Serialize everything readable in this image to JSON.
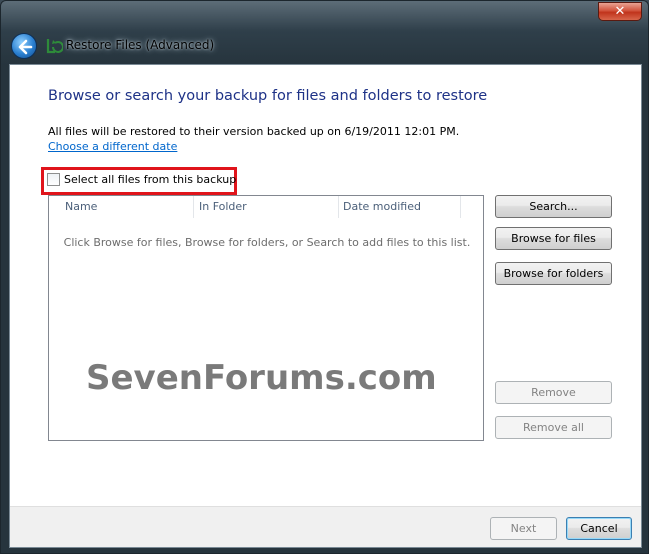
{
  "window": {
    "title": "Restore Files (Advanced)",
    "close_label": "✕"
  },
  "main": {
    "heading": "Browse or search your backup for files and folders to restore",
    "info_text": "All files will be restored to their version backed up on 6/19/2011 12:01 PM.",
    "change_date_link": "Choose a different date",
    "select_all_label": "Select all files from this backup",
    "select_all_checked": false
  },
  "list": {
    "columns": [
      "Name",
      "In Folder",
      "Date modified"
    ],
    "empty_message": "Click Browse for files, Browse for folders, or Search to add files to this list."
  },
  "side_buttons": {
    "search": "Search...",
    "browse_files": "Browse for files",
    "browse_folders": "Browse for folders",
    "remove": "Remove",
    "remove_all": "Remove all"
  },
  "footer": {
    "next": "Next",
    "cancel": "Cancel"
  },
  "watermark": "SevenForums.com",
  "colors": {
    "heading": "#1e3287",
    "link": "#0066cc",
    "highlight": "#e0141b"
  }
}
